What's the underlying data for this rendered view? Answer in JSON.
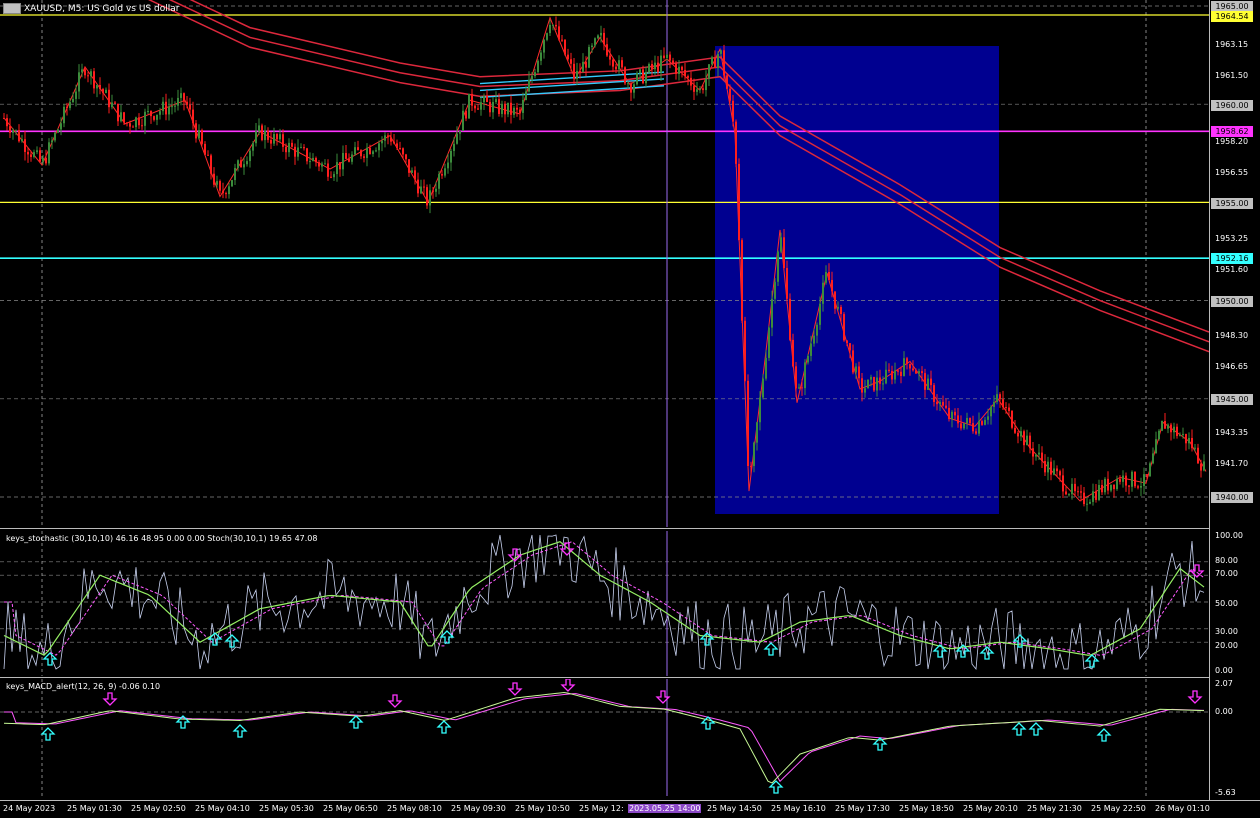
{
  "chart_header": {
    "symbol": "XAUUSD",
    "timeframe": "M5",
    "description": "US Gold vs US dollar",
    "title_text": "XAUUSD, M5:  US Gold vs US dollar"
  },
  "price_axis": {
    "labels": [
      "1963.15",
      "1961.50",
      "1958.20",
      "1956.55",
      "1953.25",
      "1951.60",
      "1948.30",
      "1946.65",
      "1943.35",
      "1941.70"
    ],
    "tags": [
      {
        "text": "1965.00",
        "bg": "#c0c0c0"
      },
      {
        "text": "1964.54",
        "bg": "#ffff33"
      },
      {
        "text": "1960.00",
        "bg": "#c0c0c0"
      },
      {
        "text": "1958.62",
        "bg": "#ff33ff"
      },
      {
        "text": "1955.00",
        "bg": "#c0c0c0"
      },
      {
        "text": "1952.16",
        "bg": "#33ffff"
      },
      {
        "text": "1950.00",
        "bg": "#c0c0c0"
      },
      {
        "text": "1945.00",
        "bg": "#c0c0c0"
      },
      {
        "text": "1940.00",
        "bg": "#c0c0c0"
      }
    ]
  },
  "stochastic": {
    "title": "keys_stochastic (30,10,10) 46.16 48.95 0.00 0.00 Stoch(30,10,1) 19.65 47.08",
    "levels": [
      "100.00",
      "80.00",
      "70.00",
      "50.00",
      "30.00",
      "20.00",
      "0.00"
    ]
  },
  "macd": {
    "title": "keys_MACD_alert(12, 26, 9) -0.06 0.10",
    "levels": [
      "2.07",
      "0.00",
      "-5.63"
    ]
  },
  "time_axis": {
    "labels": [
      "24 May 2023",
      "25 May 01:30",
      "25 May 02:50",
      "25 May 04:10",
      "25 May 05:30",
      "25 May 06:50",
      "25 May 08:10",
      "25 May 09:30",
      "25 May 10:50",
      "25 May 12:",
      "2023.05.25 14:00",
      "25 May 14:50",
      "25 May 16:10",
      "25 May 17:30",
      "25 May 18:50",
      "25 May 20:10",
      "25 May 21:30",
      "25 May 22:50",
      "26 May 01:10"
    ]
  },
  "colors": {
    "bull_candle": "#3c8c3c",
    "bear_candle": "#ff1e1e",
    "ema": "#dc283c",
    "ema_cyan": "#33ccff",
    "yellow_line": "#ffff33",
    "magenta_line": "#ff33ff",
    "cyan_line": "#33ffff",
    "zone": "#000090",
    "stoch_main": "#c8d2f0",
    "stoch_signal": "#96f064",
    "macd_main": "#c8fa96",
    "macd_signal": "#ff5aff",
    "arrow_up": "#33ffff",
    "arrow_down": "#ff33ff"
  }
}
